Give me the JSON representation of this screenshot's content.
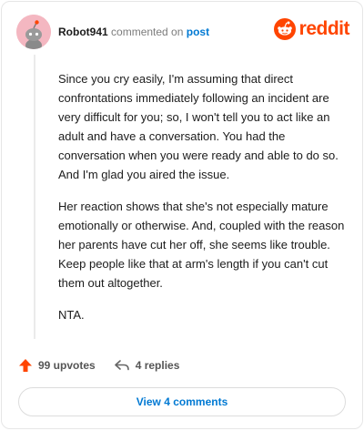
{
  "comment": {
    "author": "Robot941",
    "commented_on": "commented on",
    "post_link": "post",
    "brand": "reddit",
    "paragraphs": [
      "Since you cry easily, I'm assuming that direct confrontations immediately following an incident are very difficult for you; so, I won't tell you to act like an adult and have a conversation. You had the conversation when you were ready and able to do so. And I'm glad you aired the issue.",
      "Her reaction shows that she's not especially mature emotionally or otherwise. And, coupled with the reason her parents have cut her off, she seems like trouble. Keep people like that at arm's length if you can't cut them out altogether.",
      "NTA."
    ],
    "upvotes": "99 upvotes",
    "replies": "4 replies",
    "view_comments": "View 4 comments"
  },
  "colors": {
    "brand": "#ff4500",
    "link": "#0079d3",
    "avatar_bg": "#f4b7c1"
  },
  "icons": {
    "avatar": "snoo-avatar-icon",
    "brand": "reddit-logo-icon",
    "upvote": "upvote-arrow-icon",
    "reply": "reply-arrow-icon"
  }
}
